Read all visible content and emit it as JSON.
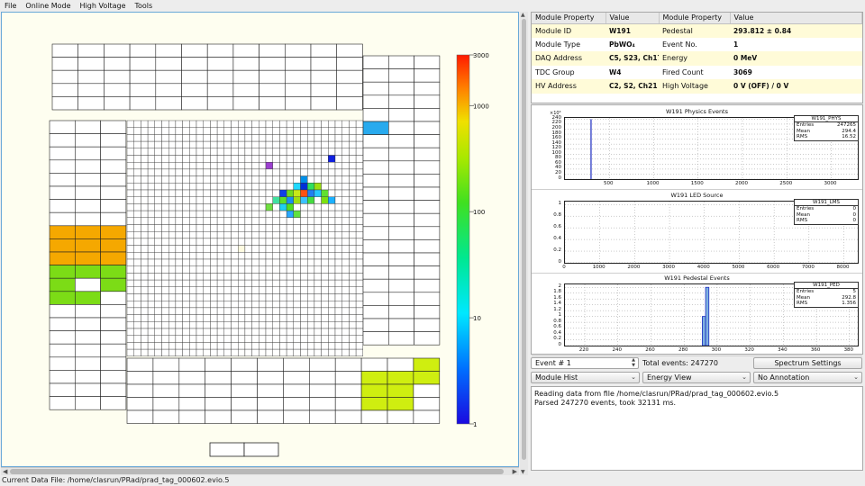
{
  "menu": [
    "File",
    "Online Mode",
    "High Voltage",
    "Tools"
  ],
  "properties": {
    "headers": [
      "Module Property",
      "Value",
      "Module Property",
      "Value"
    ],
    "rows": [
      [
        "Module ID",
        "W191",
        "Pedestal",
        "293.812 ± 0.84"
      ],
      [
        "Module Type",
        "PbWO₄",
        "Event No.",
        "1"
      ],
      [
        "DAQ Address",
        "C5, S23, Ch17",
        "Energy",
        "0 MeV"
      ],
      [
        "TDC Group",
        "W4",
        "Fired Count",
        "3069"
      ],
      [
        "HV Address",
        "C2, S2, Ch21",
        "High Voltage",
        "0 V (OFF) / 0 V"
      ]
    ]
  },
  "color_scale": {
    "labels": [
      "3000",
      "1000",
      "100",
      "10",
      "1"
    ],
    "values": [
      3000,
      1000,
      100,
      10,
      1
    ]
  },
  "histograms": [
    {
      "title": "W191 Physics Events",
      "stat_name": "W191_PHYS",
      "stats": [
        [
          "Entries",
          "247265"
        ],
        [
          "Mean",
          "294.4"
        ],
        [
          "RMS",
          "16.52"
        ]
      ],
      "y_exponent": "×10³",
      "y_ticks": [
        "240",
        "220",
        "200",
        "180",
        "160",
        "140",
        "120",
        "100",
        "80",
        "60",
        "40",
        "20",
        "0"
      ],
      "x_ticks": [
        "500",
        "1000",
        "1500",
        "2000",
        "2500",
        "3000"
      ],
      "x_range": [
        0,
        3300
      ],
      "y_range": [
        0,
        245
      ],
      "peak": {
        "x": 294,
        "y": 240
      }
    },
    {
      "title": "W191 LED Source",
      "stat_name": "W191_LMS",
      "stats": [
        [
          "Entries",
          "0"
        ],
        [
          "Mean",
          "0"
        ],
        [
          "RMS",
          "0"
        ]
      ],
      "y_exponent": "",
      "y_ticks": [
        "1",
        "0.8",
        "0.6",
        "0.4",
        "0.2",
        "0"
      ],
      "x_ticks": [
        "0",
        "1000",
        "2000",
        "3000",
        "4000",
        "5000",
        "6000",
        "7000",
        "8000"
      ],
      "x_range": [
        0,
        8400
      ],
      "y_range": [
        0,
        1.05
      ],
      "peak": null
    },
    {
      "title": "W191 Pedestal Events",
      "stat_name": "W191_PED",
      "stats": [
        [
          "Entries",
          "5"
        ],
        [
          "Mean",
          "292.8"
        ],
        [
          "RMS",
          "1.356"
        ]
      ],
      "y_exponent": "",
      "y_ticks": [
        "2",
        "1.8",
        "1.6",
        "1.4",
        "1.2",
        "1",
        "0.8",
        "0.6",
        "0.4",
        "0.2",
        "0"
      ],
      "x_ticks": [
        "220",
        "240",
        "260",
        "280",
        "300",
        "320",
        "340",
        "360",
        "380"
      ],
      "x_range": [
        208,
        385
      ],
      "y_range": [
        0,
        2.1
      ],
      "bars": [
        {
          "x": 292,
          "y": 1
        },
        {
          "x": 294,
          "y": 2
        }
      ]
    }
  ],
  "controls": {
    "event_spin": "Event # 1",
    "total_events": "Total events: 247270",
    "spectrum_button": "Spectrum Settings",
    "hist_select": "Module Hist",
    "view_select": "Energy View",
    "annotation_select": "No Annotation"
  },
  "log_lines": [
    "Reading data from file /home/clasrun/PRad/prad_tag_000602.evio.5",
    "Parsed 247270 events, took 32131 ms."
  ],
  "status": "Current Data File: /home/clasrun/PRad/prad_tag_000602.evio.5",
  "colors": {
    "accent_border": "#6aa9d8",
    "orange_module": "#f5a800",
    "green_module": "#7cdc16",
    "yellow_green_module": "#cfee10"
  }
}
